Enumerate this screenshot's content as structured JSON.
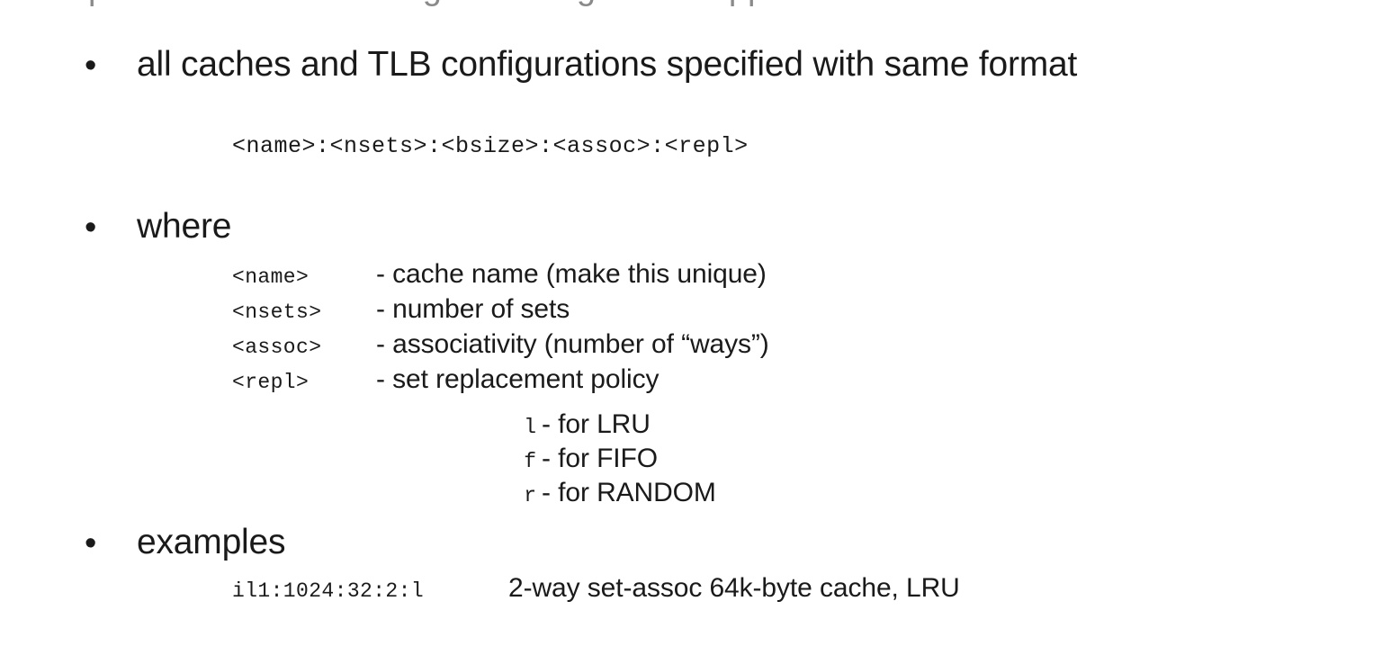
{
  "slide": {
    "background_color": "#ffffff",
    "text_color": "#1a1a1a",
    "clipped_top_line": "performance of the original configuration applies",
    "bullet_glyph": "•"
  },
  "bullets": {
    "caches": "all caches and TLB configurations specified with same format",
    "where": "where",
    "examples": "examples"
  },
  "format_spec": "<name>:<nsets>:<bsize>:<assoc>:<repl>",
  "where_list": [
    {
      "term": "<name>",
      "desc": "- cache name (make this unique)"
    },
    {
      "term": "<nsets>",
      "desc": "- number of sets"
    },
    {
      "term": "<assoc>",
      "desc": "- associativity (number of “ways”)"
    },
    {
      "term": "<repl>",
      "desc": "- set replacement policy"
    }
  ],
  "repl_policies": [
    {
      "key": "l",
      "desc": "- for LRU"
    },
    {
      "key": "f",
      "desc": "- for FIFO"
    },
    {
      "key": "r",
      "desc": "- for RANDOM"
    }
  ],
  "examples_list": [
    {
      "spec": "il1:1024:32:2:l",
      "desc": "2-way set-assoc 64k-byte cache, LRU"
    }
  ]
}
